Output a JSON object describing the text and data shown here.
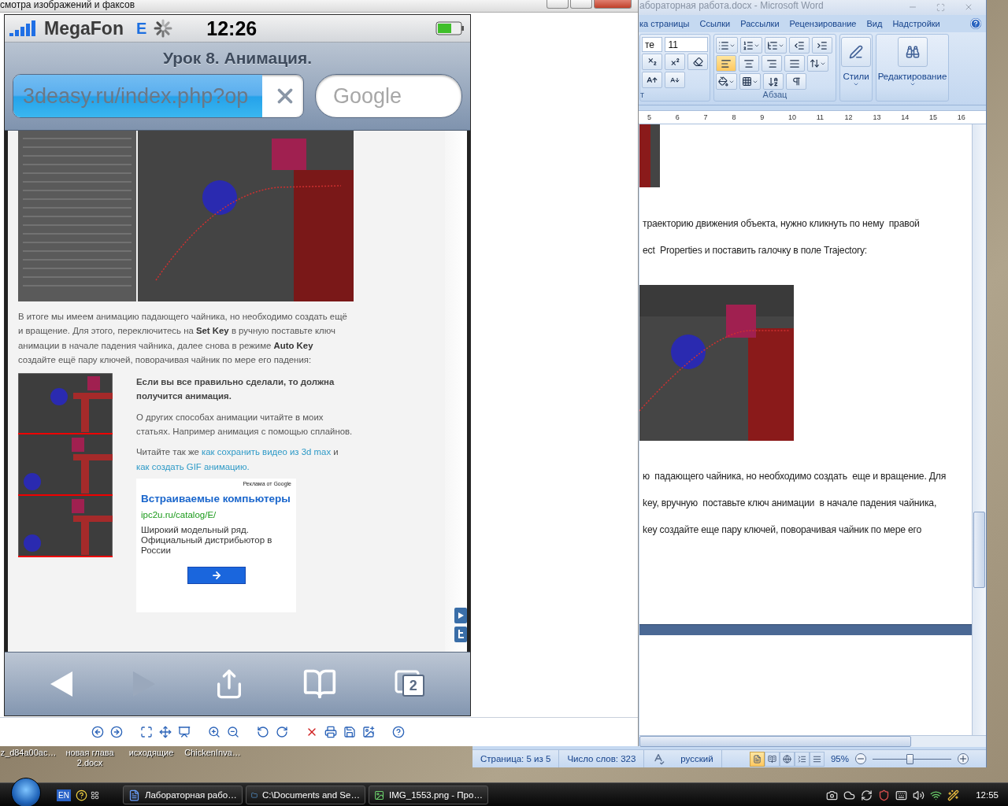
{
  "viewer": {
    "title": "смотра изображений и факсов",
    "phone": {
      "status_bar": {
        "carrier": "MegaFon",
        "network": "E",
        "time": "12:26"
      },
      "page_title": "Урок 8. Анимация.",
      "url_field": {
        "value": "3deasy.ru/index.php?op",
        "level": 0.86
      },
      "search_field": {
        "placeholder": "Google"
      },
      "article": {
        "paragraph": "В итоге мы имеем анимацию падающего чайника, но необходимо создать ещё и вращение. Для этого, переключитесь на **Set Key** в ручную поставьте ключ анимации в начале падения чайника, далее снова в режиме **Auto Key** создайте ещё пару ключей, поворачивая чайник по мере его падения:",
        "result_heading": "Если вы все правильно сделали, то должна получится анимация.",
        "other_methods": "О других способах анимации читайте в моих статьях. Например анимация с помощью сплайнов.",
        "read_also": {
          "prefix": "Читайте так же",
          "link_1": "как сохранить видео из 3d max",
          "middle": "и",
          "link_2": "как создать GIF анимацию."
        }
      },
      "ad": {
        "label": "Реклама от Google",
        "title": "Встраиваемые компьютеры",
        "url": "ipc2u.ru/catalog/E/",
        "text": "Широкий модельный ряд. Официальный дистрибьютор в России"
      },
      "toolbar": [
        {
          "kind": "back",
          "disabled": false
        },
        {
          "kind": "forward",
          "disabled": true
        },
        {
          "kind": "share",
          "disabled": false
        },
        {
          "kind": "bookmarks",
          "disabled": false
        },
        {
          "kind": "tabs",
          "disabled": false,
          "count": "2"
        }
      ]
    }
  },
  "word": {
    "title": "абораторная работа.docx - Microsoft Word",
    "ribbon_tabs": [
      "ка страницы",
      "Ссылки",
      "Рассылки",
      "Рецензирование",
      "Вид",
      "Надстройки"
    ],
    "font_name": "те",
    "font_size": "11",
    "font_group_label": "т",
    "paragraph_group_label": "Абзац",
    "styles_label": "Стили",
    "editing_label": "Редактирование",
    "alignment": [
      {
        "selected": true
      },
      {
        "selected": false
      },
      {
        "selected": false
      },
      {
        "selected": false
      }
    ],
    "ruler": [
      "5",
      "6",
      "7",
      "8",
      "9",
      "10",
      "11",
      "12",
      "13",
      "14",
      "15",
      "16"
    ],
    "doc": [
      {
        "kind": "image"
      },
      {
        "kind": "text",
        "text": "траекторию движения объекта, нужно кликнуть по нему  правой"
      },
      {
        "kind": "text",
        "text": "ect  Properties и поставить галочку в поле Trajectory:"
      },
      {
        "kind": "image"
      },
      {
        "kind": "text",
        "text": "ю  падающего чайника, но необходимо создать  еще и вращение. Для"
      },
      {
        "kind": "text",
        "text": "key, вручную  поставьте ключ анимации  в начале падения чайника,"
      },
      {
        "kind": "text",
        "text": "key создайте еще пару ключей, поворачивая чайник по мере его"
      }
    ],
    "status_bar": {
      "page": "Страница: 5 из 5",
      "words": "Число слов: 323",
      "language": "русский",
      "zoom": "95%",
      "views": [
        {
          "selected": true
        },
        {
          "selected": false
        },
        {
          "selected": false
        },
        {
          "selected": false
        },
        {
          "selected": false
        }
      ],
      "zoom_slider": {
        "level": 0.47
      }
    }
  },
  "desktop_icons": [
    {
      "label": "z_d84a00ac…"
    },
    {
      "label": "новая глава 2.docx"
    },
    {
      "label": "исходящие"
    },
    {
      "label": "ChickenInva…"
    }
  ],
  "taskbar": {
    "language": "EN",
    "tasks": [
      {
        "kind": "word",
        "label": "Лабораторная рабо…"
      },
      {
        "kind": "folder",
        "label": "C:\\Documents and Se…"
      },
      {
        "kind": "viewer",
        "label": "IMG_1553.png - Про…"
      }
    ],
    "clock": "12:55"
  }
}
